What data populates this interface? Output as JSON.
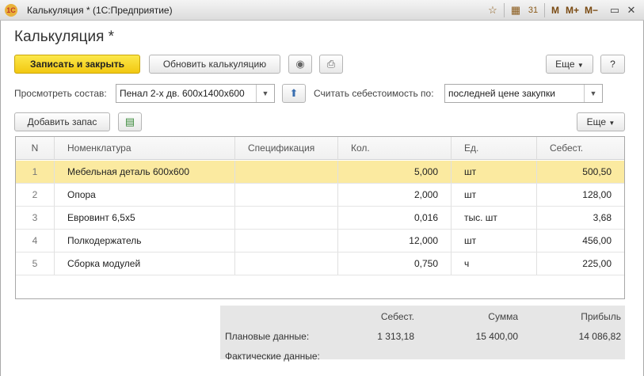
{
  "window": {
    "title": "Калькуляция * (1С:Предприятие)",
    "logo": "1С",
    "toolbar_text": {
      "m": "M",
      "m_plus": "M+",
      "m_minus": "M−"
    }
  },
  "form": {
    "title": "Калькуляция *",
    "buttons": {
      "save_close": "Записать и закрыть",
      "update": "Обновить калькуляцию",
      "more": "Еще",
      "help": "?"
    },
    "view_label": "Просмотреть состав:",
    "view_value": "Пенал 2-х дв. 600x1400x600",
    "cost_label": "Считать себестоимость по:",
    "cost_value": "последней цене закупки",
    "add_stock": "Добавить запас",
    "more2": "Еще"
  },
  "table": {
    "columns": [
      "N",
      "Номенклатура",
      "Спецификация",
      "Кол.",
      "Ед.",
      "Себест."
    ],
    "rows": [
      {
        "n": "1",
        "name": "Мебельная деталь 600x600",
        "spec": "",
        "qty": "5,000",
        "unit": "шт",
        "cost": "500,50"
      },
      {
        "n": "2",
        "name": "Опора",
        "spec": "",
        "qty": "2,000",
        "unit": "шт",
        "cost": "128,00"
      },
      {
        "n": "3",
        "name": "Евровинт 6,5x5",
        "spec": "",
        "qty": "0,016",
        "unit": "тыс. шт",
        "cost": "3,68"
      },
      {
        "n": "4",
        "name": "Полкодержатель",
        "spec": "",
        "qty": "12,000",
        "unit": "шт",
        "cost": "456,00"
      },
      {
        "n": "5",
        "name": "Сборка модулей",
        "spec": "",
        "qty": "0,750",
        "unit": "ч",
        "cost": "225,00"
      }
    ]
  },
  "summary": {
    "headers": {
      "cost": "Себест.",
      "sum": "Сумма",
      "profit": "Прибыль"
    },
    "planned_label": "Плановые данные:",
    "planned": {
      "cost": "1 313,18",
      "sum": "15 400,00",
      "profit": "14 086,82"
    },
    "actual_label": "Фактические данные:"
  }
}
